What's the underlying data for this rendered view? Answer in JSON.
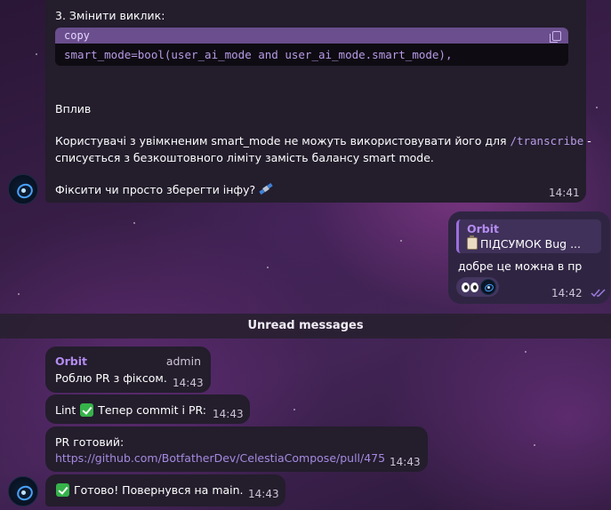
{
  "messages": {
    "first": {
      "step_text": "3. Змінити виклик:",
      "code_lang": "copy",
      "code": "smart_mode=bool(user_ai_mode and user_ai_mode.smart_mode),",
      "impact_heading": "Вплив",
      "impact_line1_before": "Користувачі з увімкненим smart_mode не можуть використовувати його для ",
      "impact_code": "/transcribe",
      "impact_line1_after": " -",
      "impact_line2": "списується з безкоштовного ліміту замість балансу smart mode.",
      "question": "Фіксити чи просто зберегти інфу?",
      "question_icon": "satellite-icon",
      "time": "14:41"
    },
    "outgoing": {
      "reply_sender": "Orbit",
      "reply_preview": "ПІДСУМОК  Bug ...",
      "reply_icon": "clipboard-icon",
      "text": "добре це можна в пр",
      "reaction_icon": "eyes-icon",
      "time": "14:42",
      "status": "read"
    },
    "unread_label": "Unread messages",
    "incoming": [
      {
        "sender": "Orbit",
        "role": "admin",
        "text": "Роблю PR з фіксом.",
        "time": "14:43"
      },
      {
        "text_before": "Lint ",
        "icon": "check-mark-icon",
        "text_after": " Тепер commit і PR:",
        "time": "14:43"
      },
      {
        "text": "PR готовий:",
        "link": "https://github.com/BotfatherDev/CelestiaCompose/pull/475",
        "time": "14:43"
      },
      {
        "icon": "check-mark-icon",
        "text_after": " Готово! Повернувся на main.",
        "time": "14:43"
      }
    ]
  },
  "colors": {
    "bubble": "#231d2c",
    "outgoing_bubble": "#2f2542",
    "accent": "#b48cf0",
    "code_text": "#b89be6",
    "link": "#a58ae0"
  }
}
